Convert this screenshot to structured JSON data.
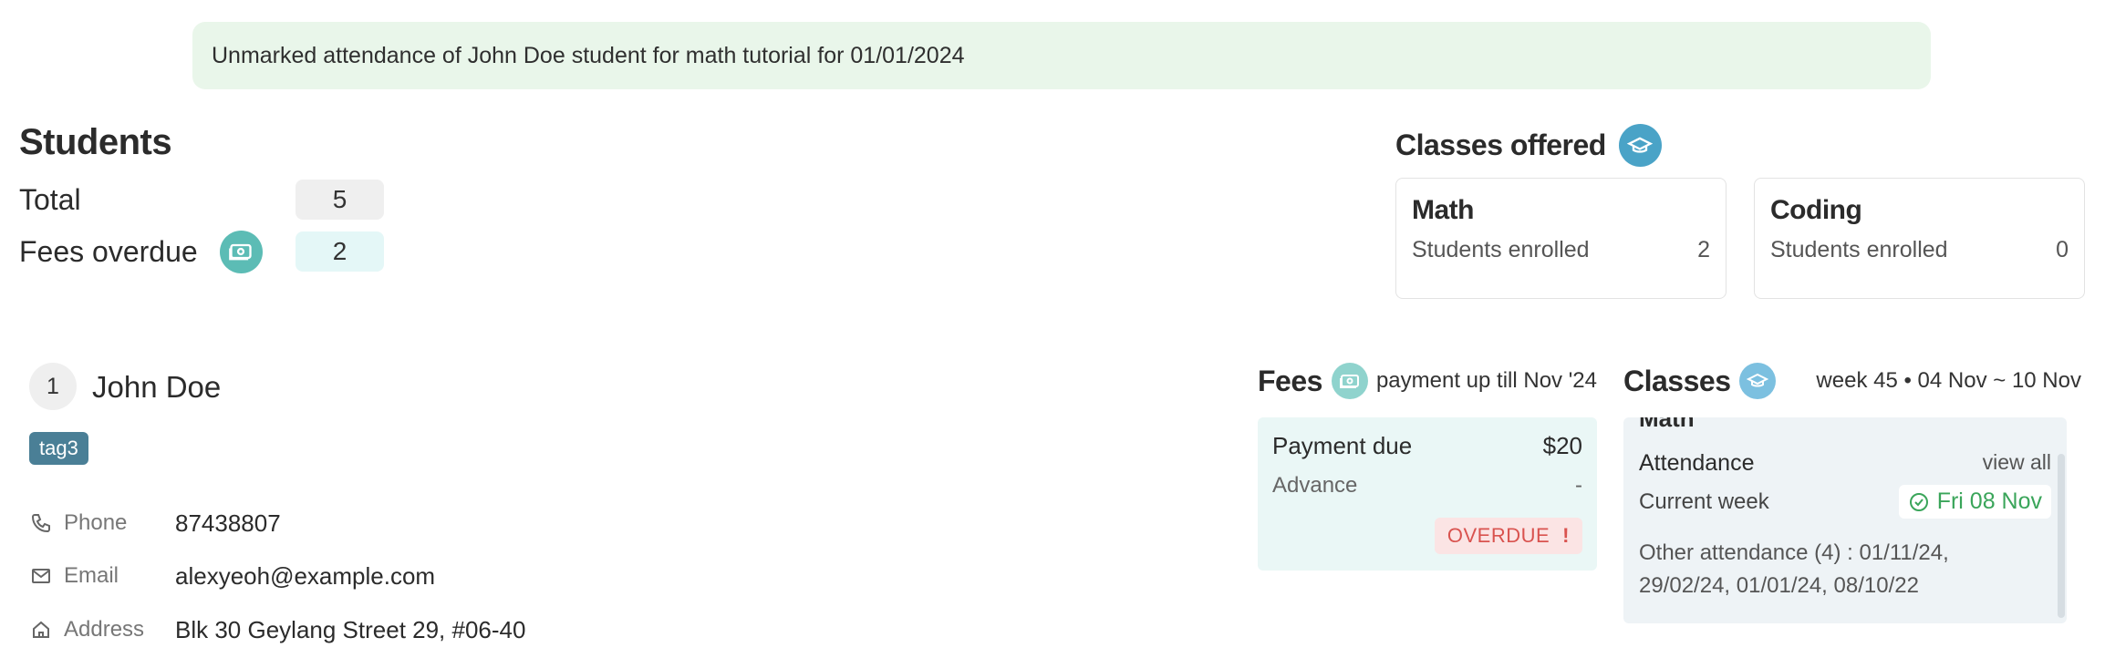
{
  "banner": {
    "message": "Unmarked attendance of John Doe student for math tutorial for 01/01/2024"
  },
  "students": {
    "title": "Students",
    "total_label": "Total",
    "total_value": "5",
    "fees_overdue_label": "Fees overdue",
    "fees_overdue_value": "2"
  },
  "classes_offered": {
    "title": "Classes offered",
    "items": [
      {
        "name": "Math",
        "label": "Students enrolled",
        "count": "2"
      },
      {
        "name": "Coding",
        "label": "Students enrolled",
        "count": "0"
      }
    ]
  },
  "person": {
    "index": "1",
    "name": "John Doe",
    "tag": "tag3",
    "phone_label": "Phone",
    "phone": "87438807",
    "email_label": "Email",
    "email": "alexyeoh@example.com",
    "address_label": "Address",
    "address": "Blk 30 Geylang Street 29, #06-40"
  },
  "fees": {
    "title": "Fees",
    "subtitle": "payment up till Nov '24",
    "payment_due_label": "Payment due",
    "payment_due_value": "$20",
    "advance_label": "Advance",
    "advance_value": "-",
    "status": "OVERDUE",
    "status_mark": "!"
  },
  "classes": {
    "title": "Classes",
    "week": "week 45 • 04 Nov ~ 10 Nov",
    "class_name": "Math",
    "attendance_label": "Attendance",
    "view_all": "view all",
    "current_week_label": "Current week",
    "current_week_date": "Fri 08 Nov",
    "other_attendance": "Other attendance (4) : 01/11/24, 29/02/24, 01/01/24, 08/10/22"
  },
  "colors": {
    "banner_bg": "#e9f6ea",
    "teal": "#5cbcb5",
    "blue": "#4aa3c7",
    "tag_bg": "#4a7f96",
    "overdue_text": "#d9534f",
    "attended_green": "#3aa55a"
  },
  "icons": [
    "money-icon",
    "graduation-cap-icon",
    "phone-icon",
    "mail-icon",
    "home-icon",
    "check-circle-icon"
  ]
}
